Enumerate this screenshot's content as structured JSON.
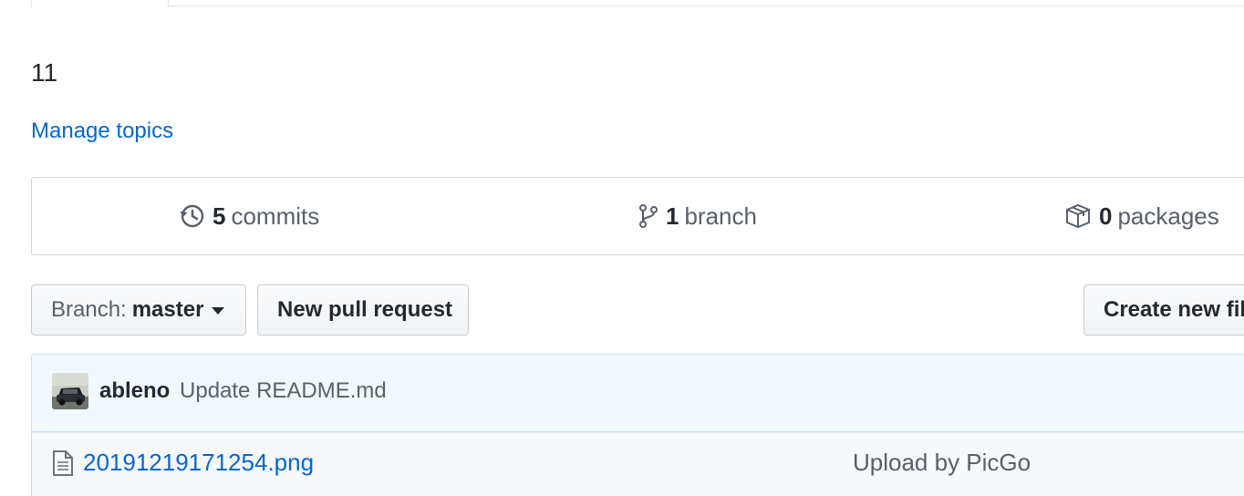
{
  "repo": {
    "description": "11",
    "manage_topics_label": "Manage topics"
  },
  "summary": {
    "commits": {
      "count": "5",
      "label": "commits",
      "icon": "history-icon"
    },
    "branches": {
      "count": "1",
      "label": "branch",
      "icon": "git-branch-icon"
    },
    "packages": {
      "count": "0",
      "label": "packages",
      "icon": "package-icon"
    }
  },
  "toolbar": {
    "branch_prefix": "Branch:",
    "branch_name": "master",
    "new_pull_request_label": "New pull request",
    "create_new_file_label": "Create new fil"
  },
  "latest_commit": {
    "author": "ableno",
    "message": "Update README.md"
  },
  "files": [
    {
      "name": "20191219171254.png",
      "commit_message": "Upload by PicGo",
      "icon": "file-icon"
    }
  ],
  "colors": {
    "link": "#0366d6",
    "text": "#24292e",
    "muted": "#586069",
    "border": "#d1d5da",
    "commit_tease_bg": "#f1f8ff",
    "commit_tease_border": "#c8e1ff"
  }
}
